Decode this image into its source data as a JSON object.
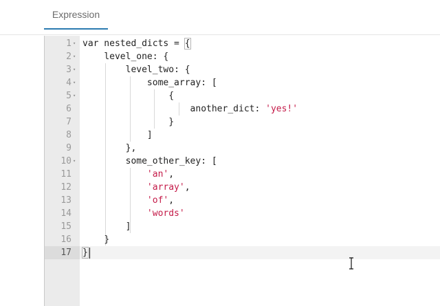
{
  "tab": {
    "label": "Expression"
  },
  "editor": {
    "active_line": 17,
    "lines": [
      {
        "num": "1",
        "fold": true,
        "indent": "",
        "tokens": [
          {
            "t": "var nested_dicts = "
          },
          {
            "t": "{",
            "hl": true
          }
        ]
      },
      {
        "num": "2",
        "fold": true,
        "indent": "    ",
        "tokens": [
          {
            "t": "level_one: {"
          }
        ]
      },
      {
        "num": "3",
        "fold": true,
        "indent": "        ",
        "tokens": [
          {
            "t": "level_two: {"
          }
        ]
      },
      {
        "num": "4",
        "fold": true,
        "indent": "            ",
        "tokens": [
          {
            "t": "some_array: ["
          }
        ]
      },
      {
        "num": "5",
        "fold": true,
        "indent": "                ",
        "tokens": [
          {
            "t": "{"
          }
        ]
      },
      {
        "num": "6",
        "fold": false,
        "indent": "                    ",
        "tokens": [
          {
            "t": "another_dict: "
          },
          {
            "t": "'yes!'",
            "s": true
          }
        ]
      },
      {
        "num": "7",
        "fold": false,
        "indent": "                ",
        "tokens": [
          {
            "t": "}"
          }
        ]
      },
      {
        "num": "8",
        "fold": false,
        "indent": "            ",
        "tokens": [
          {
            "t": "]"
          }
        ]
      },
      {
        "num": "9",
        "fold": false,
        "indent": "        ",
        "tokens": [
          {
            "t": "},"
          }
        ]
      },
      {
        "num": "10",
        "fold": true,
        "indent": "        ",
        "tokens": [
          {
            "t": "some_other_key: ["
          }
        ]
      },
      {
        "num": "11",
        "fold": false,
        "indent": "            ",
        "tokens": [
          {
            "t": "'an'",
            "s": true
          },
          {
            "t": ","
          }
        ]
      },
      {
        "num": "12",
        "fold": false,
        "indent": "            ",
        "tokens": [
          {
            "t": "'array'",
            "s": true
          },
          {
            "t": ","
          }
        ]
      },
      {
        "num": "13",
        "fold": false,
        "indent": "            ",
        "tokens": [
          {
            "t": "'of'",
            "s": true
          },
          {
            "t": ","
          }
        ]
      },
      {
        "num": "14",
        "fold": false,
        "indent": "            ",
        "tokens": [
          {
            "t": "'words'",
            "s": true
          }
        ]
      },
      {
        "num": "15",
        "fold": false,
        "indent": "        ",
        "tokens": [
          {
            "t": "]"
          }
        ]
      },
      {
        "num": "16",
        "fold": false,
        "indent": "    ",
        "tokens": [
          {
            "t": "}"
          }
        ]
      },
      {
        "num": "17",
        "fold": false,
        "indent": "",
        "tokens": [
          {
            "t": "}",
            "hl": true
          }
        ]
      }
    ]
  },
  "icons": {
    "fold": "fold-arrow-icon",
    "cursor": "text-cursor-icon"
  },
  "colors": {
    "accent": "#2b7ab0",
    "string": "#c41a48",
    "gutter": "#ebebeb"
  }
}
